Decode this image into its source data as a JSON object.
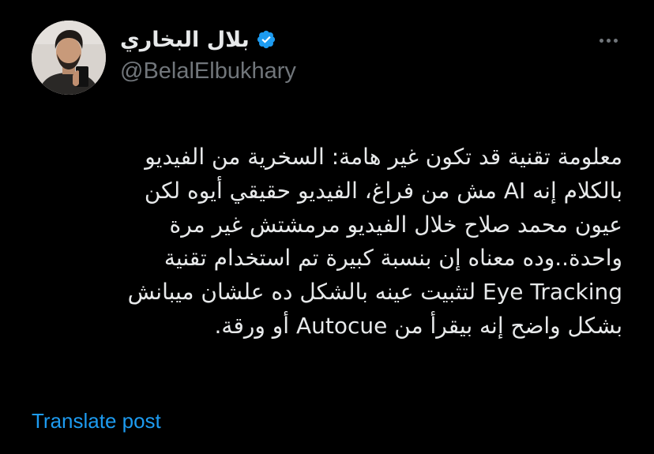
{
  "author": {
    "display_name": "بلال البخاري",
    "handle": "@BelalElbukhary",
    "verified": true,
    "avatar_icon": "profile-photo"
  },
  "header": {
    "more_icon": "more-horizontal-icon"
  },
  "post": {
    "lines": [
      "معلومة تقنية قد تكون غير هامة: السخرية من الفيديو",
      "بالكلام إنه AI مش من فراغ، الفيديو حقيقي أيوه لكن",
      "عيون محمد صلاح خلال الفيديو مرمشتش غير مرة",
      "واحدة..وده معناه إن بنسبة كبيرة تم استخدام تقنية",
      "Eye Tracking لتثبيت عينه بالشكل ده علشان ميبانش",
      "بشكل واضح إنه بيقرأ من Autocue أو ورقة."
    ]
  },
  "actions": {
    "translate_label": "Translate post"
  },
  "colors": {
    "background": "#000000",
    "text_primary": "#e7e9ea",
    "text_secondary": "#71767b",
    "link": "#1d9bf0",
    "verified_badge": "#1d9bf0"
  }
}
